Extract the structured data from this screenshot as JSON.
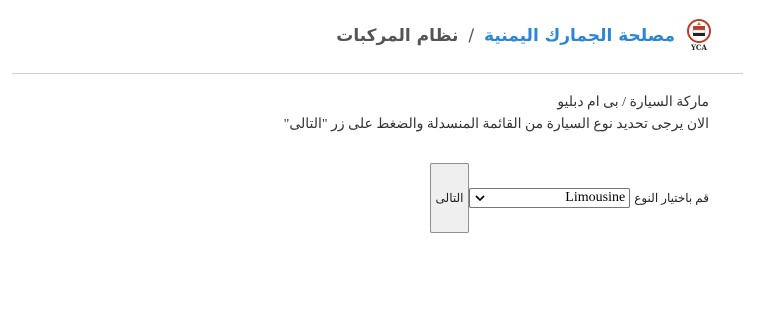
{
  "header": {
    "org_name": "مصلحة الجمارك اليمنية",
    "separator": "/",
    "system_name": "نظام المركبات",
    "logo_caption": "YCA",
    "logo_icon": "yemen-customs-emblem-icon"
  },
  "info": {
    "brand_line": "ماركة السيارة / بى ام دبليو",
    "instruction_line": "الان يرجى تحديد نوع السيارة من القائمة المنسدلة والضغط على زر \"التالى\""
  },
  "form": {
    "type_label": "قم باختيار النوع",
    "type_selected": "Limousine",
    "next_label": "التالى"
  }
}
